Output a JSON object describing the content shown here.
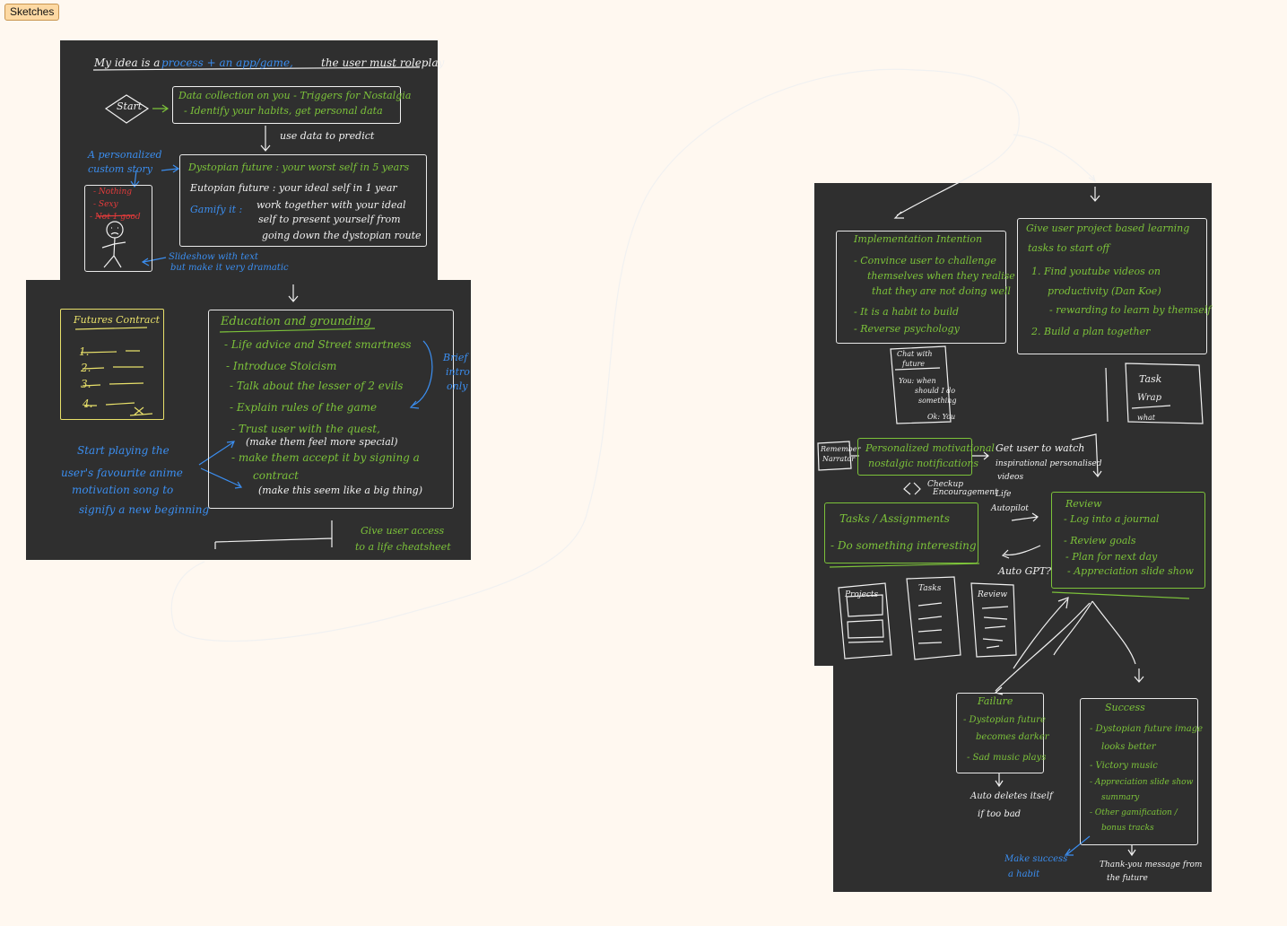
{
  "tab": {
    "label": "Sketches"
  },
  "board1": {
    "title_a": "My idea is a",
    "title_b": "process + an app/game,",
    "title_c": "the user must roleplay",
    "start": "Start",
    "data_1": "Data collection on you   - Triggers for Nostalgia",
    "data_2": "- Identify your habits, get personal data",
    "use_data": "use data to predict",
    "note_1": "A personalized",
    "note_2": "custom story",
    "dys": "Dystopian future : your worst self in 5 years",
    "eut": "Eutopian future : your ideal self in 1 year",
    "gam_1": "Gamify it :",
    "gam_2": "work together with your ideal",
    "gam_3": "self to present yourself from",
    "gam_4": "going down the dystopian route",
    "red_1": "- Nothing",
    "red_2": "- Sexy",
    "red_3": "- Not 1 good",
    "slide_1": "Slideshow with text",
    "slide_2": "but make it very dramatic"
  },
  "board2": {
    "contract_title": "Futures Contract",
    "contract_lines": [
      "1.",
      "2.",
      "3.",
      "4."
    ],
    "edu_title": "Education and grounding",
    "edu_1": "- Life advice and Street smartness",
    "edu_2": "- Introduce Stoicism",
    "edu_3": "- Talk about the lesser of 2 evils",
    "edu_4": "- Explain rules of the game",
    "edu_5": "- Trust user with the quest,",
    "edu_6": "(make them feel more special)",
    "edu_7": "- make them accept it by signing a",
    "edu_8": "contract",
    "edu_9": "(make this seem like a big thing)",
    "brief_1": "Brief",
    "brief_2": "intro",
    "brief_3": "only",
    "music_1": "Start playing the",
    "music_2": "user's favourite anime",
    "music_3": "motivation song to",
    "music_4": "signify a new beginning",
    "access_1": "Give user access",
    "access_2": "to a life cheatsheet"
  },
  "board3": {
    "impl_title": "Implementation Intention",
    "impl_1": "- Convince user to challenge",
    "impl_2": "themselves when they realise",
    "impl_3": "that they are not doing well",
    "impl_4": "- It is a habit to build",
    "impl_5": "- Reverse psychology",
    "proj_1": "Give user project based learning",
    "proj_2": "tasks to start off",
    "proj_3": "1. Find youtube videos on",
    "proj_4": "productivity (Dan Koe)",
    "proj_5": "- rewarding to learn by themself",
    "proj_6": "2. Build a plan together",
    "chat_1": "Chat with",
    "chat_2": "future",
    "chat_3": "You: when",
    "chat_4": "should I do",
    "chat_5": "something",
    "chat_6": "Ok: You",
    "task_1": "Task",
    "task_2": "Wrap",
    "task_3": "what",
    "rem_1": "Remember",
    "rem_2": "Narrator",
    "pers_1": "Personalized motivational",
    "pers_2": "nostalgic notifications",
    "checkup_1": "Checkup",
    "checkup_2": "Encouragement",
    "watch_1": "Get user to watch",
    "watch_2": "inspirational personalised",
    "watch_3": "videos",
    "life_1": "Life",
    "life_2": "Autopilot",
    "tasks_title": "Tasks / Assignments",
    "tasks_1": "- Do something interesting",
    "autogpt": "Auto GPT?",
    "review_title": "Review",
    "review_1": "- Log into a journal",
    "review_2": "- Review goals",
    "review_3": "- Plan for next day",
    "review_4": "- Appreciation slide show",
    "phone_1": "Projects",
    "phone_2": "Tasks",
    "phone_3": "Review",
    "fail_title": "Failure",
    "fail_1": "- Dystopian future",
    "fail_2": "becomes darker",
    "fail_3": "- Sad music plays",
    "succ_title": "Success",
    "succ_1": "- Dystopian future image",
    "succ_2": "looks better",
    "succ_3": "- Victory music",
    "succ_4": "- Appreciation slide show",
    "succ_5": "summary",
    "succ_6": "- Other gamification /",
    "succ_7": "bonus tracks",
    "auto_1": "Auto deletes itself",
    "auto_2": "if too bad",
    "habit_1": "Make success",
    "habit_2": "a habit",
    "thanks_1": "Thank-you message from",
    "thanks_2": "the future"
  }
}
